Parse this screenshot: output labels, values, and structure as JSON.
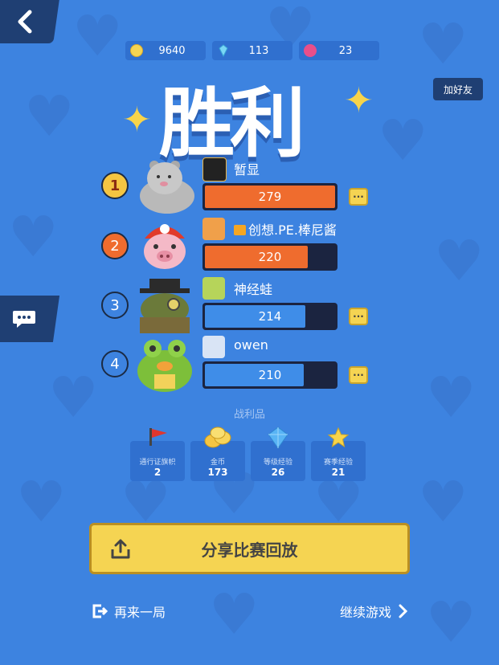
{
  "currency": {
    "coins": "9640",
    "gems": "113",
    "tickets": "23"
  },
  "header": {
    "title": "胜利",
    "add_friend": "加好友"
  },
  "rankings": [
    {
      "rank": "1",
      "name": "暂显",
      "score": "279",
      "fill_fraction": 1.0,
      "bar_color": "#ef6c2e",
      "has_more": true
    },
    {
      "rank": "2",
      "name": "创想.PE.棒尼酱",
      "score": "220",
      "fill_fraction": 0.79,
      "bar_color": "#ef6c2e",
      "has_more": false
    },
    {
      "rank": "3",
      "name": "神经蛙",
      "score": "214",
      "fill_fraction": 0.77,
      "bar_color": "#3f8de8",
      "has_more": true
    },
    {
      "rank": "4",
      "name": "owen",
      "score": "210",
      "fill_fraction": 0.76,
      "bar_color": "#3f8de8",
      "has_more": true
    }
  ],
  "loot": {
    "title": "战利品",
    "items": [
      {
        "label": "通行证旗帜",
        "value": "2",
        "icon": "flag-icon"
      },
      {
        "label": "金币",
        "value": "173",
        "icon": "coins-icon"
      },
      {
        "label": "等级经验",
        "value": "26",
        "icon": "crystal-icon"
      },
      {
        "label": "赛季经验",
        "value": "21",
        "icon": "star-icon"
      }
    ]
  },
  "actions": {
    "share": "分享比赛回放",
    "play_again": "再来一局",
    "continue": "继续游戏"
  },
  "colors": {
    "background": "#3d83e0",
    "dark_panel": "#1f3f73",
    "gold": "#f5d452",
    "orange_bar": "#ef6c2e",
    "blue_bar": "#3f8de8"
  }
}
